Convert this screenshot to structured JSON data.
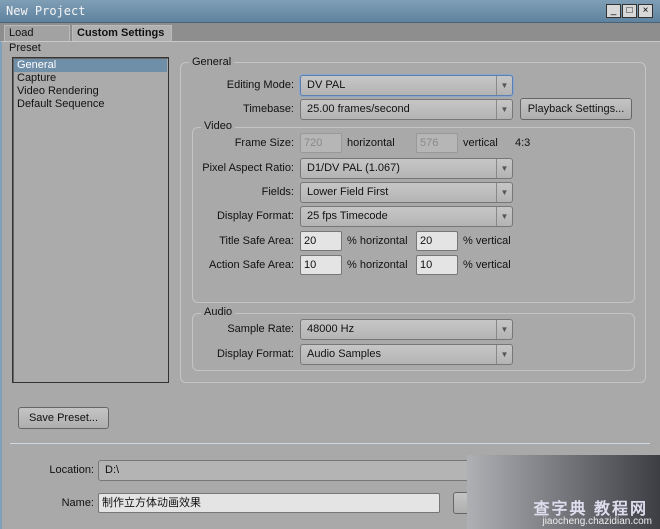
{
  "window": {
    "title": "New Project",
    "buttons": [
      "_",
      "□",
      "×"
    ]
  },
  "tabs": [
    {
      "label": "Load Preset"
    },
    {
      "label": "Custom Settings"
    }
  ],
  "nav": {
    "items": [
      "General",
      "Capture",
      "Video Rendering",
      "Default Sequence"
    ],
    "selected": "General"
  },
  "general": {
    "group_label": "General",
    "editing_mode_label": "Editing Mode:",
    "editing_mode": "DV PAL",
    "timebase_label": "Timebase:",
    "timebase": "25.00 frames/second",
    "playback_button": "Playback Settings..."
  },
  "video": {
    "group_label": "Video",
    "frame_size_label": "Frame Size:",
    "frame_w": "720",
    "horizontal": "horizontal",
    "frame_h": "576",
    "vertical": "vertical",
    "aspect": "4:3",
    "par_label": "Pixel Aspect Ratio:",
    "par": "D1/DV PAL (1.067)",
    "fields_label": "Fields:",
    "fields": "Lower Field First",
    "display_format_label": "Display Format:",
    "display_format": "25 fps Timecode",
    "title_safe_label": "Title Safe Area:",
    "title_safe_h": "20",
    "title_safe_v": "20",
    "action_safe_label": "Action Safe Area:",
    "action_safe_h": "10",
    "action_safe_v": "10",
    "pct_h": "% horizontal",
    "pct_v": "% vertical"
  },
  "audio": {
    "group_label": "Audio",
    "sample_rate_label": "Sample Rate:",
    "sample_rate": "48000 Hz",
    "display_format_label": "Display Format:",
    "display_format": "Audio Samples"
  },
  "save_preset": "Save Preset...",
  "location": {
    "label": "Location:",
    "value": "D:\\"
  },
  "name": {
    "label": "Name:",
    "value": "制作立方体动画效果"
  },
  "watermark": {
    "brand": "查字典 教程网",
    "url": "jiaocheng.chazidian.com"
  }
}
